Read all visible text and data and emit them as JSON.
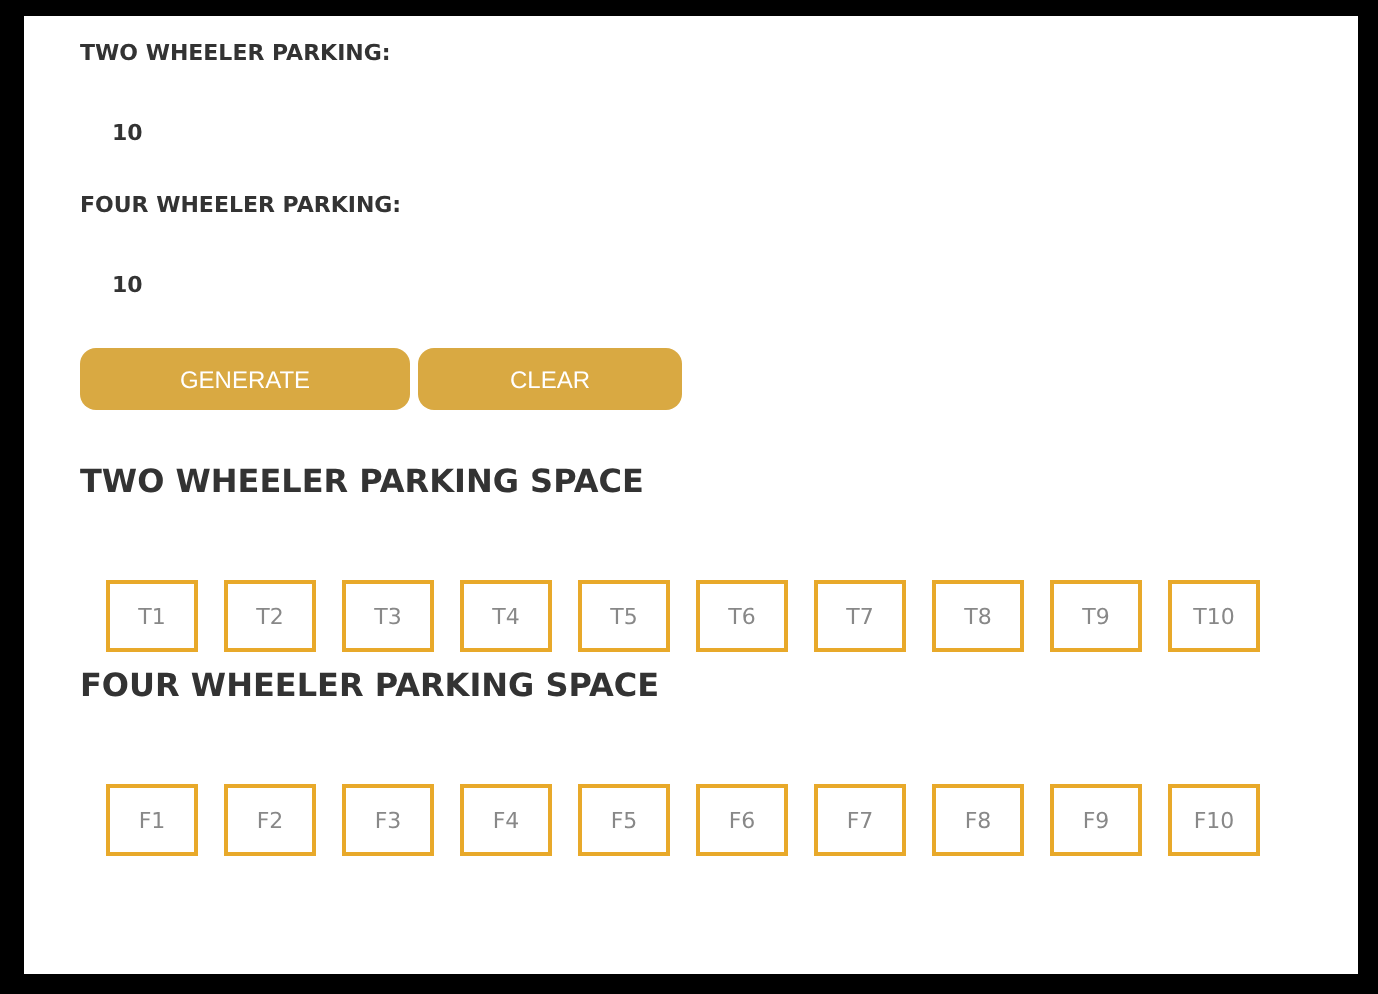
{
  "fields": [
    {
      "label": "TWO WHEELER PARKING:",
      "value": "10"
    },
    {
      "label": "FOUR WHEELER PARKING:",
      "value": "10"
    }
  ],
  "buttons": [
    "GENERATE",
    "CLEAR"
  ],
  "sections": [
    {
      "title": "TWO WHEELER PARKING SPACE",
      "slots": [
        "T1",
        "T2",
        "T3",
        "T4",
        "T5",
        "T6",
        "T7",
        "T8",
        "T9",
        "T10"
      ]
    },
    {
      "title": "FOUR WHEELER PARKING SPACE",
      "slots": [
        "F1",
        "F2",
        "F3",
        "F4",
        "F5",
        "F6",
        "F7",
        "F8",
        "F9",
        "F10"
      ]
    }
  ]
}
